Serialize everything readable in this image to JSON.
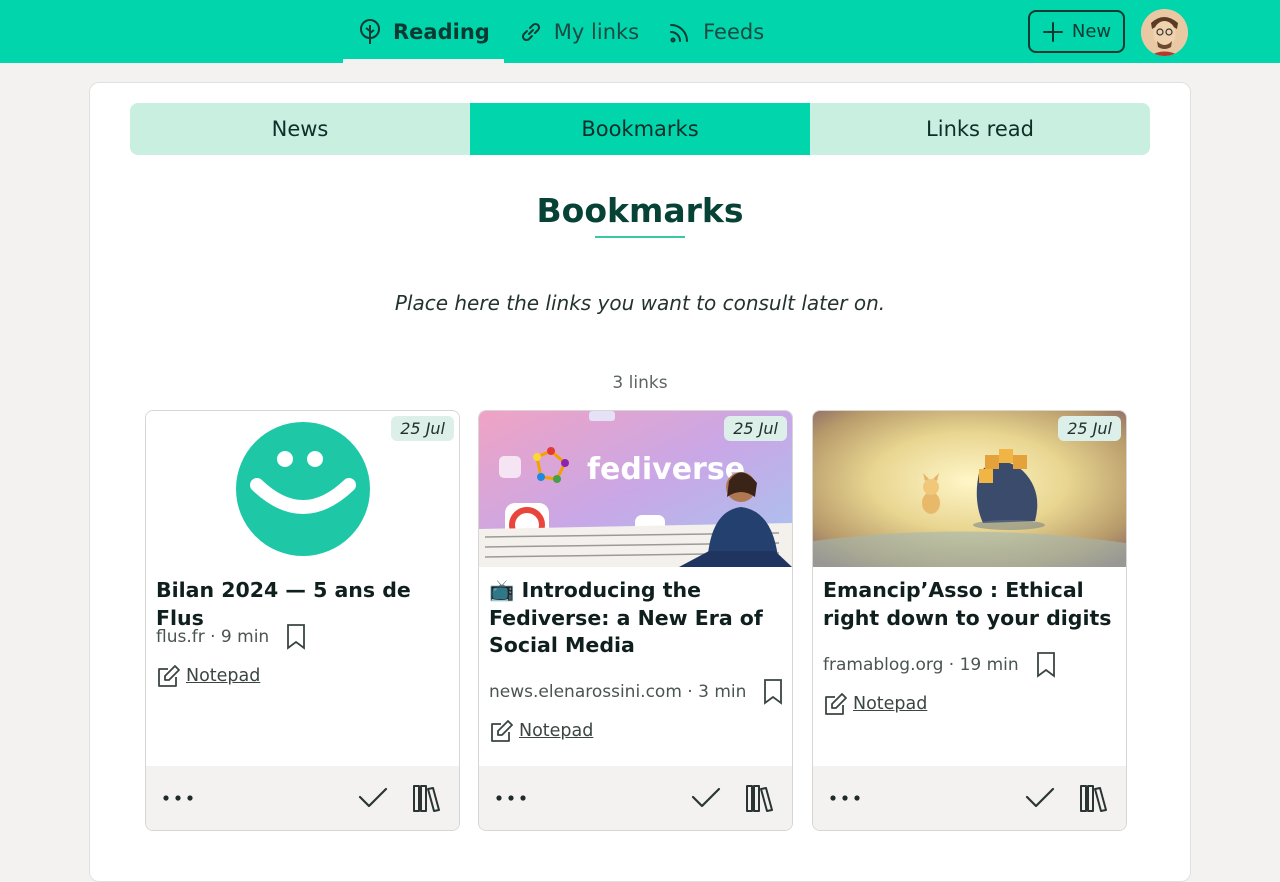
{
  "header": {
    "nav": [
      {
        "label": "Reading",
        "icon": "tree-icon",
        "active": true
      },
      {
        "label": "My links",
        "icon": "link-icon",
        "active": false
      },
      {
        "label": "Feeds",
        "icon": "rss-icon",
        "active": false
      }
    ],
    "new_label": "New"
  },
  "tabs": [
    {
      "label": "News",
      "active": false
    },
    {
      "label": "Bookmarks",
      "active": true
    },
    {
      "label": "Links read",
      "active": false
    }
  ],
  "page": {
    "title": "Bookmarks",
    "intro": "Place here the links you want to consult later on.",
    "count": "3 links"
  },
  "cards": [
    {
      "date": "25 Jul",
      "title": "Bilan 2024 — 5 ans de Flus",
      "source": "flus.fr · 9 min",
      "notepad": " Notepad",
      "image": "flus-logo"
    },
    {
      "date": "25 Jul",
      "title": "📺 Introducing the Fediverse: a New Era of Social Media",
      "source": "news.elenarossini.com · 3 min",
      "notepad": " Notepad",
      "image": "fediverse-thumbnail",
      "image_text": "fediverse"
    },
    {
      "date": "25 Jul",
      "title": "Emancip’Asso : Ethical right down to your digits",
      "source": "framablog.org · 19 min",
      "notepad": " Notepad",
      "image": "framablog-illustration"
    }
  ],
  "colors": {
    "accent": "#00d5ab",
    "tab_inactive": "#c9efe1",
    "title": "#064235"
  }
}
